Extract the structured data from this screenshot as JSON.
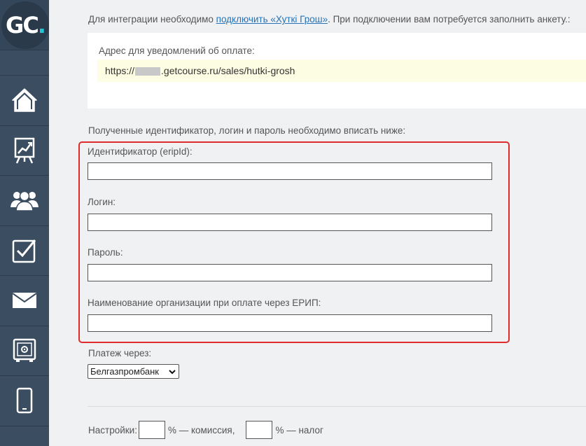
{
  "sidebar": {
    "logo_text": "GC",
    "logo_dot": ".",
    "accent": "#22c4d6",
    "items": [
      {
        "icon": "home-icon"
      },
      {
        "icon": "chart-board-icon"
      },
      {
        "icon": "users-icon"
      },
      {
        "icon": "checkbox-icon"
      },
      {
        "icon": "mail-icon"
      },
      {
        "icon": "safe-icon"
      },
      {
        "icon": "mobile-icon"
      }
    ]
  },
  "intro": {
    "prefix": "Для интеграции необходимо ",
    "link": "подключить «Хуткі Грош»",
    "suffix": ". При подключении вам потребуется заполнить анкету.:"
  },
  "notify": {
    "label": "Адрес для уведомлений об оплате:",
    "url_prefix": "https://",
    "url_suffix": ".getcourse.ru/sales/hutki-grosh"
  },
  "hint": "Полученные идентификатор, логин и пароль необходимо вписать ниже:",
  "fields": {
    "erip_id_label": "Идентификатор (eripId):",
    "login_label": "Логин:",
    "password_label": "Пароль:",
    "org_name_label": "Наименование организации при оплате через ЕРИП:"
  },
  "payment": {
    "label": "Платеж через:",
    "selected": "Белгазпромбанк"
  },
  "settings": {
    "label": "Настройки:",
    "commission": "% — комиссия,",
    "tax": "% — налог"
  },
  "highlight_color": "#e02b2b"
}
